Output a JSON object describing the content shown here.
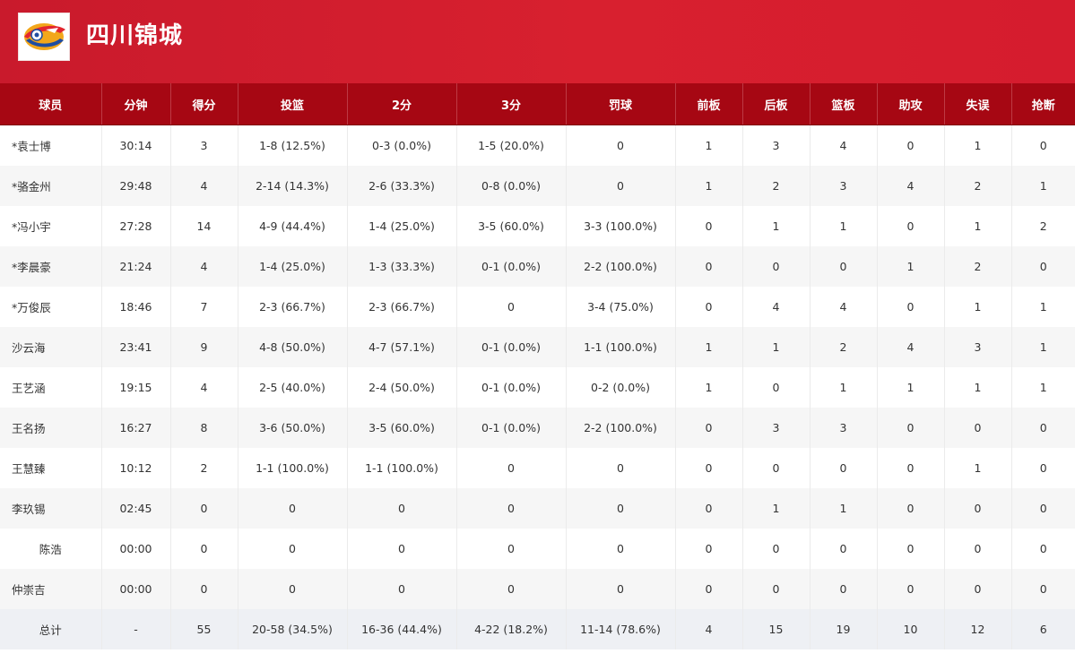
{
  "header": {
    "team_name": "四川锦城",
    "logo_icon": "team-logo-icon",
    "bg_color": "#d51c2e"
  },
  "table": {
    "header_color": "#a60713",
    "columns": [
      "球员",
      "分钟",
      "得分",
      "投篮",
      "2分",
      "3分",
      "罚球",
      "前板",
      "后板",
      "篮板",
      "助攻",
      "失误",
      "抢断"
    ],
    "rows": [
      [
        "*袁士博",
        "30:14",
        "3",
        "1-8 (12.5%)",
        "0-3 (0.0%)",
        "1-5 (20.0%)",
        "0",
        "1",
        "3",
        "4",
        "0",
        "1",
        "0"
      ],
      [
        "*骆金州",
        "29:48",
        "4",
        "2-14 (14.3%)",
        "2-6 (33.3%)",
        "0-8 (0.0%)",
        "0",
        "1",
        "2",
        "3",
        "4",
        "2",
        "1"
      ],
      [
        "*冯小宇",
        "27:28",
        "14",
        "4-9 (44.4%)",
        "1-4 (25.0%)",
        "3-5 (60.0%)",
        "3-3 (100.0%)",
        "0",
        "1",
        "1",
        "0",
        "1",
        "2"
      ],
      [
        "*李晨豪",
        "21:24",
        "4",
        "1-4 (25.0%)",
        "1-3 (33.3%)",
        "0-1 (0.0%)",
        "2-2 (100.0%)",
        "0",
        "0",
        "0",
        "1",
        "2",
        "0"
      ],
      [
        "*万俊辰",
        "18:46",
        "7",
        "2-3 (66.7%)",
        "2-3 (66.7%)",
        "0",
        "3-4 (75.0%)",
        "0",
        "4",
        "4",
        "0",
        "1",
        "1"
      ],
      [
        "沙云海",
        "23:41",
        "9",
        "4-8 (50.0%)",
        "4-7 (57.1%)",
        "0-1 (0.0%)",
        "1-1 (100.0%)",
        "1",
        "1",
        "2",
        "4",
        "3",
        "1"
      ],
      [
        "王艺涵",
        "19:15",
        "4",
        "2-5 (40.0%)",
        "2-4 (50.0%)",
        "0-1 (0.0%)",
        "0-2 (0.0%)",
        "1",
        "0",
        "1",
        "1",
        "1",
        "1"
      ],
      [
        "王名扬",
        "16:27",
        "8",
        "3-6 (50.0%)",
        "3-5 (60.0%)",
        "0-1 (0.0%)",
        "2-2 (100.0%)",
        "0",
        "3",
        "3",
        "0",
        "0",
        "0"
      ],
      [
        "王慧臻",
        "10:12",
        "2",
        "1-1 (100.0%)",
        "1-1 (100.0%)",
        "0",
        "0",
        "0",
        "0",
        "0",
        "0",
        "1",
        "0"
      ],
      [
        "李玖锡",
        "02:45",
        "0",
        "0",
        "0",
        "0",
        "0",
        "0",
        "1",
        "1",
        "0",
        "0",
        "0"
      ],
      [
        "陈浩",
        "00:00",
        "0",
        "0",
        "0",
        "0",
        "0",
        "0",
        "0",
        "0",
        "0",
        "0",
        "0"
      ],
      [
        "仲崇吉",
        "00:00",
        "0",
        "0",
        "0",
        "0",
        "0",
        "0",
        "0",
        "0",
        "0",
        "0",
        "0"
      ]
    ],
    "total": [
      "总计",
      "-",
      "55",
      "20-58 (34.5%)",
      "16-36 (44.4%)",
      "4-22 (18.2%)",
      "11-14 (78.6%)",
      "4",
      "15",
      "19",
      "10",
      "12",
      "6"
    ]
  }
}
